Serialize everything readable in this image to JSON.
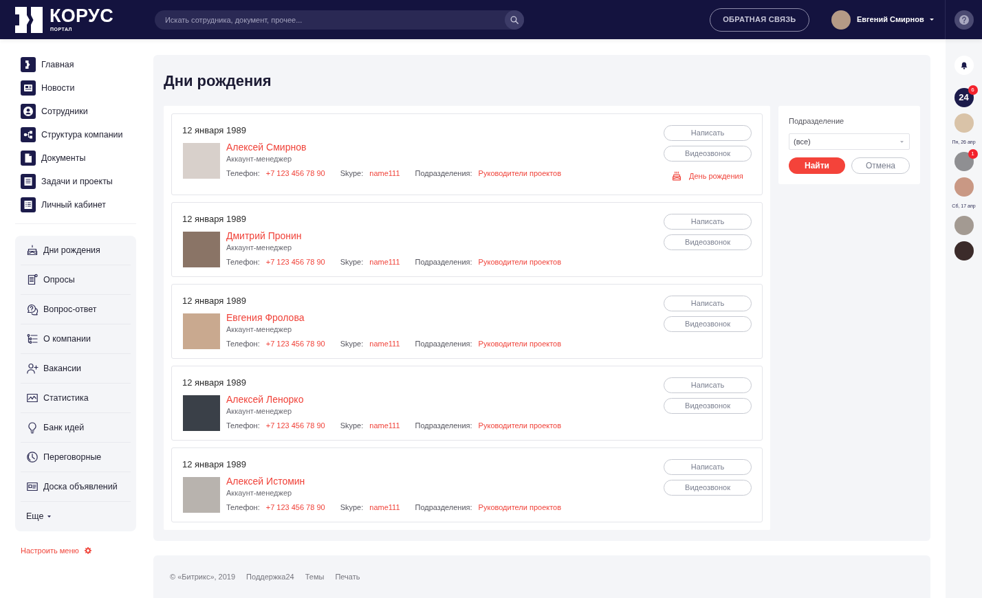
{
  "header": {
    "logo": {
      "title": "КОРУС",
      "subtitle": "ПОРТАЛ"
    },
    "search": {
      "placeholder": "Искать сотрудника, документ, прочее..."
    },
    "feedback_button": "ОБРАТНАЯ СВЯЗЬ",
    "user": {
      "name": "Евгений Смирнов"
    }
  },
  "sidebar": {
    "main_items": [
      "Главная",
      "Новости",
      "Сотрудники",
      "Структура компании",
      "Документы",
      "Задачи и проекты",
      "Личный кабинет"
    ],
    "extra_items": [
      "Дни рождения",
      "Опросы",
      "Вопрос-ответ",
      "О компании",
      "Вакансии",
      "Статистика",
      "Банк идей",
      "Переговорные",
      "Доска объявлений"
    ],
    "more": "Еще",
    "configure": "Настроить меню"
  },
  "page": {
    "title": "Дни рождения"
  },
  "birthdays": [
    {
      "date": "12 января 1989",
      "name": "Алексей Смирнов",
      "position": "Аккаунт-менеджер",
      "contacts": [
        {
          "label": "Телефон:",
          "value": "+7 123 456 78 90"
        },
        {
          "label": "Skype:",
          "value": "name111"
        },
        {
          "label": "Подразделения:",
          "value": "Руководители проектов"
        }
      ],
      "buttons": [
        "Написать",
        "Видеозвонок"
      ],
      "birthday_link": "День рождения"
    },
    {
      "date": "12 января 1989",
      "name": "Дмитрий Пронин",
      "position": "Аккаунт-менеджер",
      "contacts": [
        {
          "label": "Телефон:",
          "value": "+7 123 456 78 90"
        },
        {
          "label": "Skype:",
          "value": "name111"
        },
        {
          "label": "Подразделения:",
          "value": "Руководители проектов"
        }
      ],
      "buttons": [
        "Написать",
        "Видеозвонок"
      ]
    },
    {
      "date": "12 января 1989",
      "name": "Евгения Фролова",
      "position": "Аккаунт-менеджер",
      "contacts": [
        {
          "label": "Телефон:",
          "value": "+7 123 456 78 90"
        },
        {
          "label": "Skype:",
          "value": "name111"
        },
        {
          "label": "Подразделения:",
          "value": "Руководители проектов"
        }
      ],
      "buttons": [
        "Написать",
        "Видеозвонок"
      ]
    },
    {
      "date": "12 января 1989",
      "name": "Алексей Ленорко",
      "position": "Аккаунт-менеджер",
      "contacts": [
        {
          "label": "Телефон:",
          "value": "+7 123 456 78 90"
        },
        {
          "label": "Skype:",
          "value": "name111"
        },
        {
          "label": "Подразделения:",
          "value": "Руководители проектов"
        }
      ],
      "buttons": [
        "Написать",
        "Видеозвонок"
      ]
    },
    {
      "date": "12 января 1989",
      "name": "Алексей Истомин",
      "position": "Аккаунт-менеджер",
      "contacts": [
        {
          "label": "Телефон:",
          "value": "+7 123 456 78 90"
        },
        {
          "label": "Skype:",
          "value": "name111"
        },
        {
          "label": "Подразделения:",
          "value": "Руководители проектов"
        }
      ],
      "buttons": [
        "Написать",
        "Видеозвонок"
      ]
    }
  ],
  "filter": {
    "label": "Подразделение",
    "select": {
      "value": "(все)"
    },
    "buttons": [
      {
        "label": "Найти",
        "kind": "primary"
      },
      {
        "label": "Отмена",
        "kind": "secondary"
      }
    ]
  },
  "right_rail": [
    {
      "kind": "bell"
    },
    {
      "kind": "app",
      "text": "24",
      "badge": "6"
    },
    {
      "kind": "avatar"
    },
    {
      "kind": "date",
      "text": "Пн, 26 апр"
    },
    {
      "kind": "avatar",
      "badge": "1"
    },
    {
      "kind": "avatar"
    },
    {
      "kind": "date",
      "text": "Сб, 17 апр"
    },
    {
      "kind": "avatar"
    },
    {
      "kind": "avatar"
    }
  ],
  "footer": {
    "copyright": "© «Битрикс», 2019",
    "links": [
      "Поддержка24",
      "Темы",
      "Печать"
    ]
  }
}
